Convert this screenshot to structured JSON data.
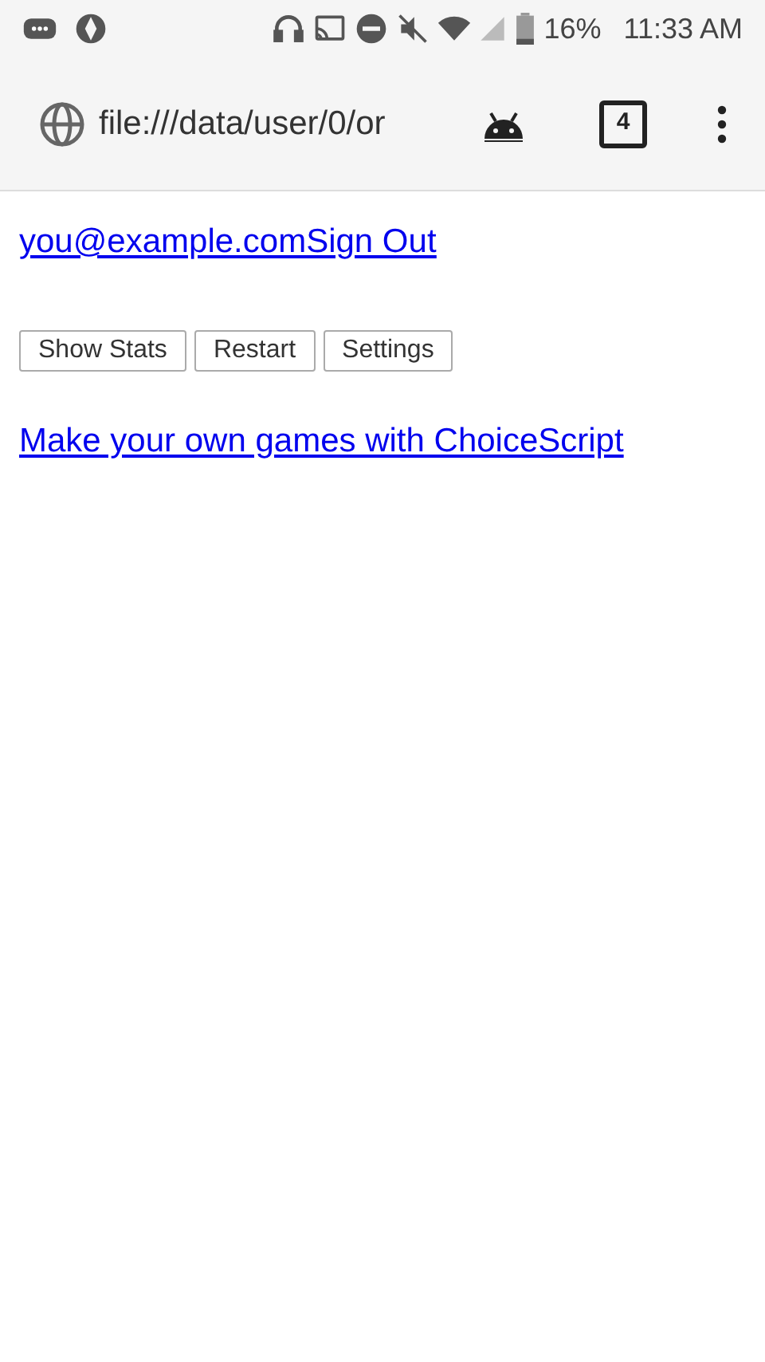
{
  "status_bar": {
    "battery": "16%",
    "time": "11:33 AM"
  },
  "browser": {
    "url": "file:///data/user/0/or",
    "tab_count": "4"
  },
  "account": {
    "email": "you@example.com",
    "sign_out": "Sign Out"
  },
  "buttons": [
    "Show Stats",
    "Restart",
    "Settings"
  ],
  "footer_link": "Make your own games with ChoiceScript"
}
